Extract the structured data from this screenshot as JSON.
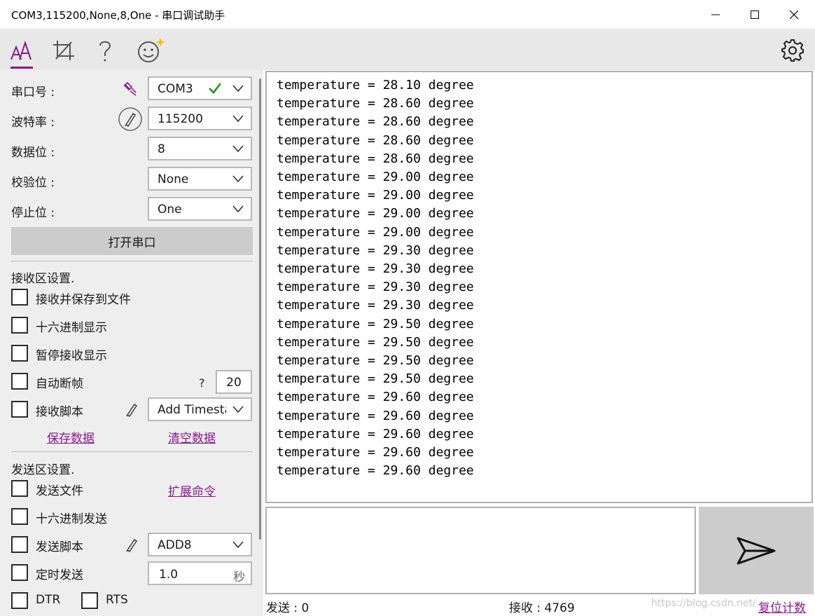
{
  "window": {
    "title": "COM3,115200,None,8,One - 串口调试助手"
  },
  "toolbar": {
    "icons": [
      "font-icon",
      "crop-icon",
      "help-icon",
      "smiley-icon",
      "settings-icon"
    ]
  },
  "serial": {
    "port_label": "串口号 :",
    "port_value": "COM3",
    "baud_label": "波特率 :",
    "baud_value": "115200",
    "databits_label": "数据位 :",
    "databits_value": "8",
    "parity_label": "校验位 :",
    "parity_value": "None",
    "stopbits_label": "停止位 :",
    "stopbits_value": "One",
    "open_button": "打开串口"
  },
  "receive_settings": {
    "heading": "接收区设置.",
    "save_to_file": "接收并保存到文件",
    "hex_display": "十六进制显示",
    "pause_display": "暂停接收显示",
    "auto_frame": "自动断帧",
    "auto_frame_help": "?",
    "auto_frame_value": "20",
    "script_label": "接收脚本",
    "script_value": "Add Timestamp",
    "save_data": "保存数据",
    "clear_data": "清空数据"
  },
  "send_settings": {
    "heading": "发送区设置.",
    "send_file": "发送文件",
    "extend_cmd": "扩展命令",
    "hex_send": "十六进制发送",
    "script_label": "发送脚本",
    "script_value": "ADD8",
    "timed_send": "定时发送",
    "timer_value": "1.0",
    "timer_unit": "秒",
    "dtr": "DTR",
    "rts": "RTS"
  },
  "receive_area": {
    "lines": [
      "temperature = 28.10 degree",
      "temperature = 28.60 degree",
      "temperature = 28.60 degree",
      "temperature = 28.60 degree",
      "temperature = 28.60 degree",
      "temperature = 29.00 degree",
      "temperature = 29.00 degree",
      "temperature = 29.00 degree",
      "temperature = 29.00 degree",
      "temperature = 29.30 degree",
      "temperature = 29.30 degree",
      "temperature = 29.30 degree",
      "temperature = 29.30 degree",
      "temperature = 29.50 degree",
      "temperature = 29.50 degree",
      "temperature = 29.50 degree",
      "temperature = 29.50 degree",
      "temperature = 29.60 degree",
      "temperature = 29.60 degree",
      "temperature = 29.60 degree",
      "temperature = 29.60 degree",
      "temperature = 29.60 degree"
    ]
  },
  "status": {
    "sent_label": "发送 : 0",
    "received_label": "接收 : 4769",
    "reset_count": "复位计数",
    "watermark": "https://blog.csdn.net/"
  },
  "colors": {
    "accent": "#8a1a8a",
    "check": "#1a9a1a"
  }
}
